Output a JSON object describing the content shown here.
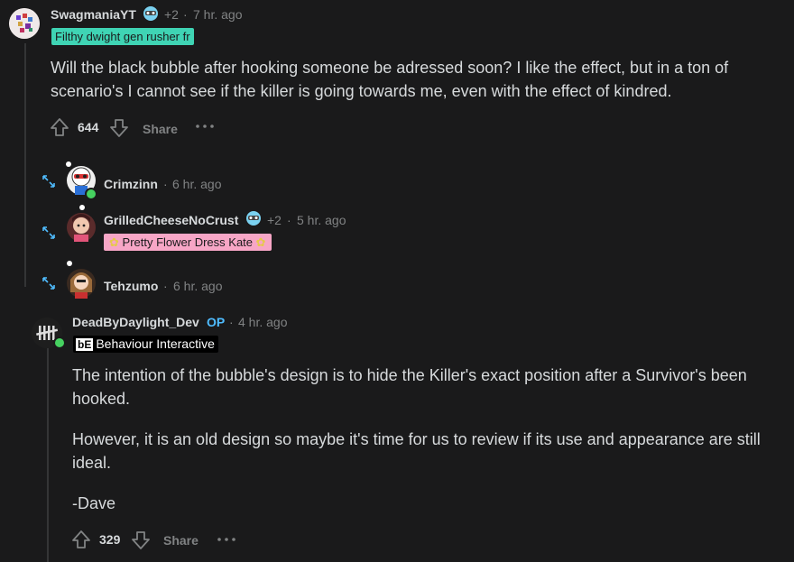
{
  "comments": [
    {
      "username": "SwagmaniaYT",
      "awards": "+2",
      "time": "7 hr. ago",
      "flair": "Filthy dwight gen rusher fr",
      "flair_bg": "#3fd4b4",
      "body": "Will the black bubble after hooking someone be adressed soon? I like the effect, but in a ton of scenario's I cannot see if the killer is going towards me, even with the effect of kindred.",
      "votes": "644",
      "share": "Share"
    },
    {
      "username": "Crimzinn",
      "time": "6 hr. ago"
    },
    {
      "username": "GrilledCheeseNoCrust",
      "awards": "+2",
      "time": "5 hr. ago",
      "flair": "Pretty Flower Dress Kate",
      "flair_bg": "#f7a6c6"
    },
    {
      "username": "Tehzumo",
      "time": "6 hr. ago"
    },
    {
      "username": "DeadByDaylight_Dev",
      "op": "OP",
      "time": "4 hr. ago",
      "flair_logo": "bE",
      "flair": "Behaviour Interactive",
      "paragraphs": [
        "The intention of the bubble's design is to hide the Killer's exact position after a Survivor's been hooked.",
        "However, it is an old design so maybe it's time for us to review if its use and appearance are still ideal.",
        "-Dave"
      ],
      "votes": "329",
      "share": "Share"
    }
  ],
  "colors": {
    "background": "#1a1a1b",
    "text": "#d7dadc",
    "muted": "#818384",
    "op": "#4fbcff",
    "online": "#46d160"
  },
  "icons": [
    "upvote-icon",
    "downvote-icon",
    "more-icon",
    "expand-icon",
    "award-icon"
  ]
}
